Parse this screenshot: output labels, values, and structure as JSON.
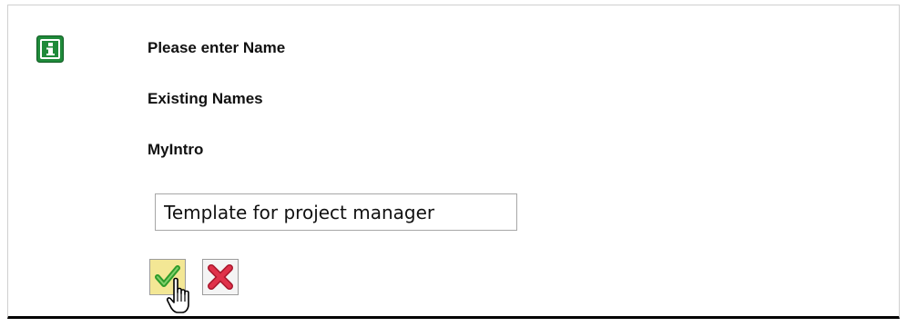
{
  "dialog": {
    "icon": "info-icon",
    "prompt": "Please enter Name",
    "existing_label": "Existing Names",
    "existing_value": "MyIntro",
    "name_input": {
      "value": "Template for project manager"
    },
    "confirm_icon": "checkmark-icon",
    "cancel_icon": "close-x-icon",
    "cursor_icon": "hand-pointer-icon"
  },
  "colors": {
    "info_green": "#1f8a3a",
    "confirm_bg": "#f3e795",
    "check_green": "#2e9c2a",
    "cancel_red": "#e0314a"
  }
}
